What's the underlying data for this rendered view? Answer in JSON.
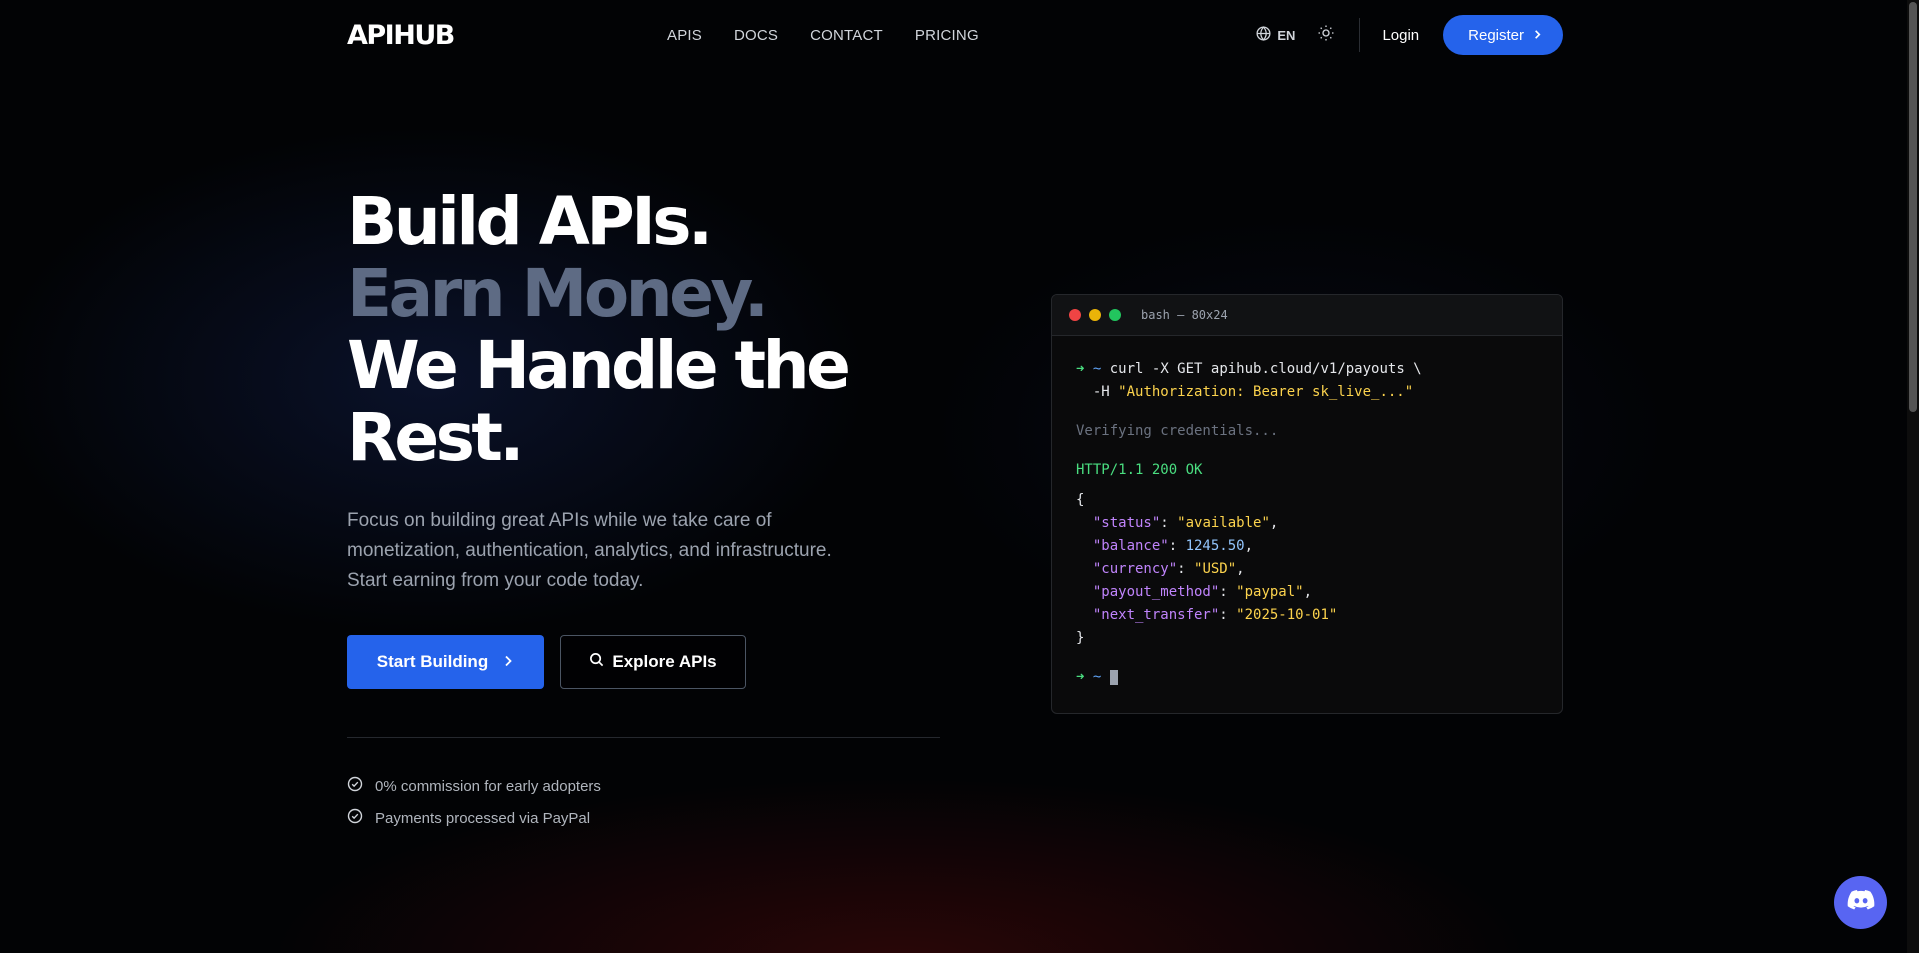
{
  "header": {
    "logo": "APIHUB",
    "nav": [
      "APIS",
      "DOCS",
      "CONTACT",
      "PRICING"
    ],
    "language": "EN",
    "login_label": "Login",
    "register_label": "Register"
  },
  "hero": {
    "title_lines": [
      "Build APIs.",
      "Earn Money.",
      "We Handle the",
      "Rest."
    ],
    "subtitle_lines": [
      "Focus on building great APIs while we take care of",
      "monetization, authentication, analytics, and infrastructure.",
      "Start earning from your code today."
    ],
    "primary_button": "Start Building",
    "secondary_button": "Explore APIs",
    "checks": [
      "0% commission for early adopters",
      "Payments processed via PayPal"
    ]
  },
  "terminal": {
    "title": "bash — 80x24",
    "command_arrow": "➜",
    "command_tilde": "~",
    "command": "curl -X GET apihub.cloud/v1/payouts \\",
    "header_flag": "  -H ",
    "header_value": "\"Authorization: Bearer sk_live_...\"",
    "verifying": "Verifying credentials...",
    "http_status": "HTTP/1.1 200 OK",
    "open_brace": "{",
    "close_brace": "}",
    "json": [
      {
        "key": "\"status\"",
        "value": "\"available\"",
        "kind": "string",
        "comma": ","
      },
      {
        "key": "\"balance\"",
        "value": "1245.50",
        "kind": "number",
        "comma": ","
      },
      {
        "key": "\"currency\"",
        "value": "\"USD\"",
        "kind": "string",
        "comma": ","
      },
      {
        "key": "\"payout_method\"",
        "value": "\"paypal\"",
        "kind": "string",
        "comma": ","
      },
      {
        "key": "\"next_transfer\"",
        "value": "\"2025-10-01\"",
        "kind": "string",
        "comma": ""
      }
    ]
  },
  "colors": {
    "accent": "#2563eb",
    "muted_title": "#5e6b84",
    "discord": "#5865f2",
    "term_red": "#ef4444",
    "term_yellow": "#eab308",
    "term_green": "#22c55e"
  }
}
